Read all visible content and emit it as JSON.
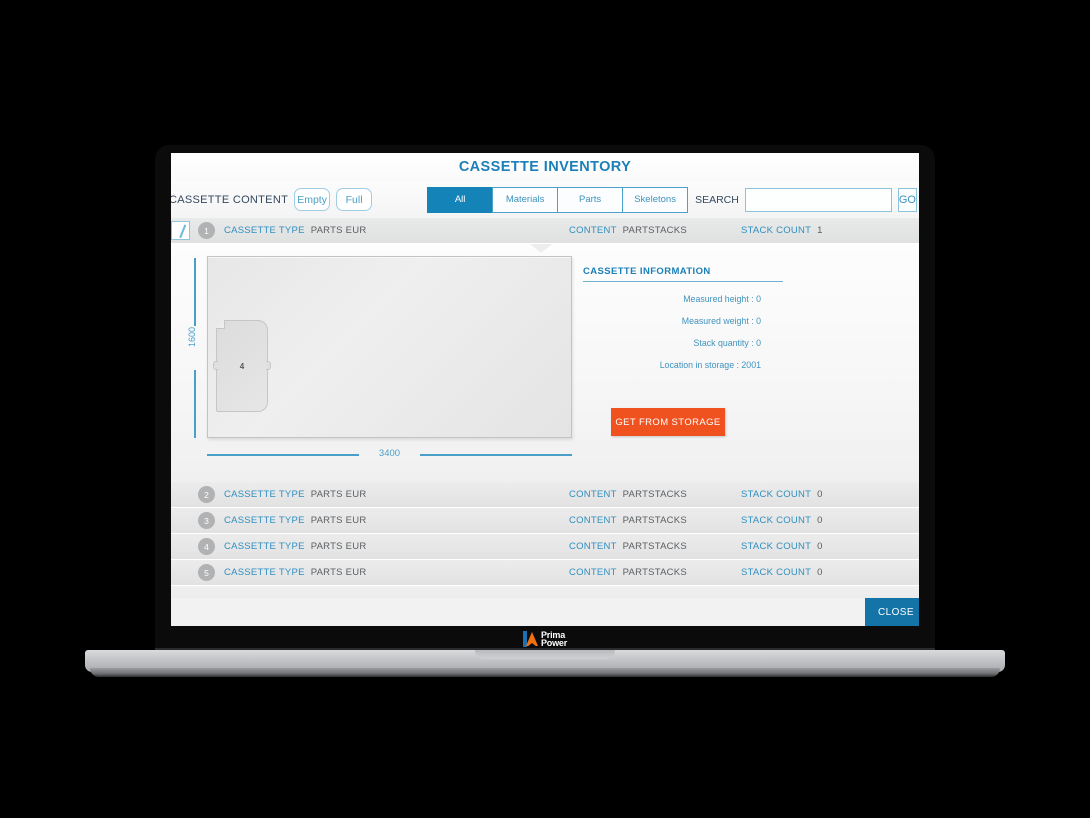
{
  "window": {
    "title": "CASSETTE INVENTORY"
  },
  "toolbar": {
    "content_label": "CASSETTE CONTENT",
    "empty_label": "Empty",
    "full_label": "Full",
    "tabs": [
      {
        "label": "All",
        "active": true
      },
      {
        "label": "Materials",
        "active": false
      },
      {
        "label": "Parts",
        "active": false
      },
      {
        "label": "Skeletons",
        "active": false
      }
    ],
    "search_label": "SEARCH",
    "search_value": "",
    "search_placeholder": "",
    "go_label": "GO"
  },
  "list": {
    "labels": {
      "cassette_type": "CASSETTE TYPE",
      "content": "CONTENT",
      "stack_count": "STACK COUNT"
    },
    "rows": [
      {
        "index": "1",
        "cassette_type": "PARTS EUR",
        "content": "PARTSTACKS",
        "stack_count": "1",
        "selected": true
      },
      {
        "index": "2",
        "cassette_type": "PARTS EUR",
        "content": "PARTSTACKS",
        "stack_count": "0",
        "selected": false
      },
      {
        "index": "3",
        "cassette_type": "PARTS EUR",
        "content": "PARTSTACKS",
        "stack_count": "0",
        "selected": false
      },
      {
        "index": "4",
        "cassette_type": "PARTS EUR",
        "content": "PARTSTACKS",
        "stack_count": "0",
        "selected": false
      },
      {
        "index": "5",
        "cassette_type": "PARTS EUR",
        "content": "PARTSTACKS",
        "stack_count": "0",
        "selected": false
      }
    ]
  },
  "detail": {
    "diagram": {
      "width_dimension": "3400",
      "height_dimension": "1600",
      "part_label": "4"
    },
    "info_title": "CASSETTE INFORMATION",
    "info_rows": [
      "Measured height : 0",
      "Measured weight : 0",
      "Stack quantity : 0",
      "Location in storage : 2001"
    ],
    "action_label": "GET FROM STORAGE"
  },
  "footer": {
    "close_label": "CLOSE"
  },
  "brand": {
    "name_line1": "Prima",
    "name_line2": "Power"
  },
  "colors": {
    "accent_blue": "#1483b8",
    "title_blue": "#1b7fb8",
    "label_blue": "#2f8fc0",
    "orange": "#f0521f",
    "close_blue": "#1474a8"
  }
}
